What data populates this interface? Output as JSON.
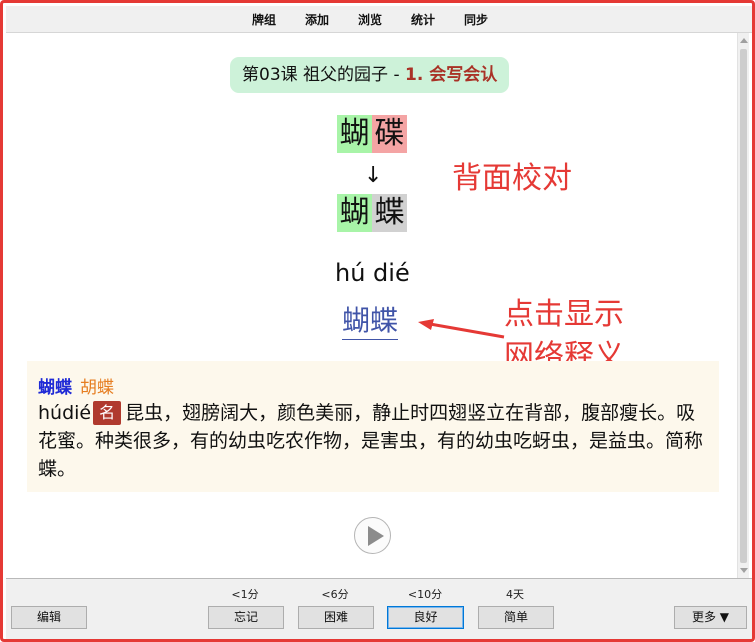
{
  "menu": {
    "items": [
      "牌组",
      "添加",
      "浏览",
      "统计",
      "同步"
    ]
  },
  "card": {
    "lesson": "第03课 祖父的园子 - ",
    "part": "1. 会写会认",
    "typed": [
      "蝴",
      "碟"
    ],
    "answer": [
      "蝴",
      "蝶"
    ],
    "arrow": "↓",
    "pinyin": "hú dié",
    "word_link": "蝴蝶"
  },
  "annotations": {
    "back_check": "背面校对",
    "click_hint_line1": "点击显示",
    "click_hint_line2": "网络释义"
  },
  "definition": {
    "word": "蝴蝶",
    "variant": "胡蝶",
    "pinyin": "húdié",
    "pos": "名",
    "text": "昆虫，翅膀阔大，颜色美丽，静止时四翅竖立在背部，腹部瘦长。吸花蜜。种类很多，有的幼虫吃农作物，是害虫，有的幼虫吃蚜虫，是益虫。简称蝶。"
  },
  "bottom": {
    "edit_label": "编辑",
    "more_label": "更多 ▼",
    "answers": [
      {
        "interval": "<1分",
        "label": "忘记"
      },
      {
        "interval": "<6分",
        "label": "困难"
      },
      {
        "interval": "<10分",
        "label": "良好"
      },
      {
        "interval": "4天",
        "label": "简单"
      }
    ]
  },
  "colors": {
    "accent_red": "#e53935",
    "correct_green": "#a8f4a8",
    "wrong_red": "#f4a4a4",
    "link_blue": "#4054a8"
  },
  "icons": {
    "play": "play-icon",
    "arrow": "annotation-arrow-icon"
  }
}
